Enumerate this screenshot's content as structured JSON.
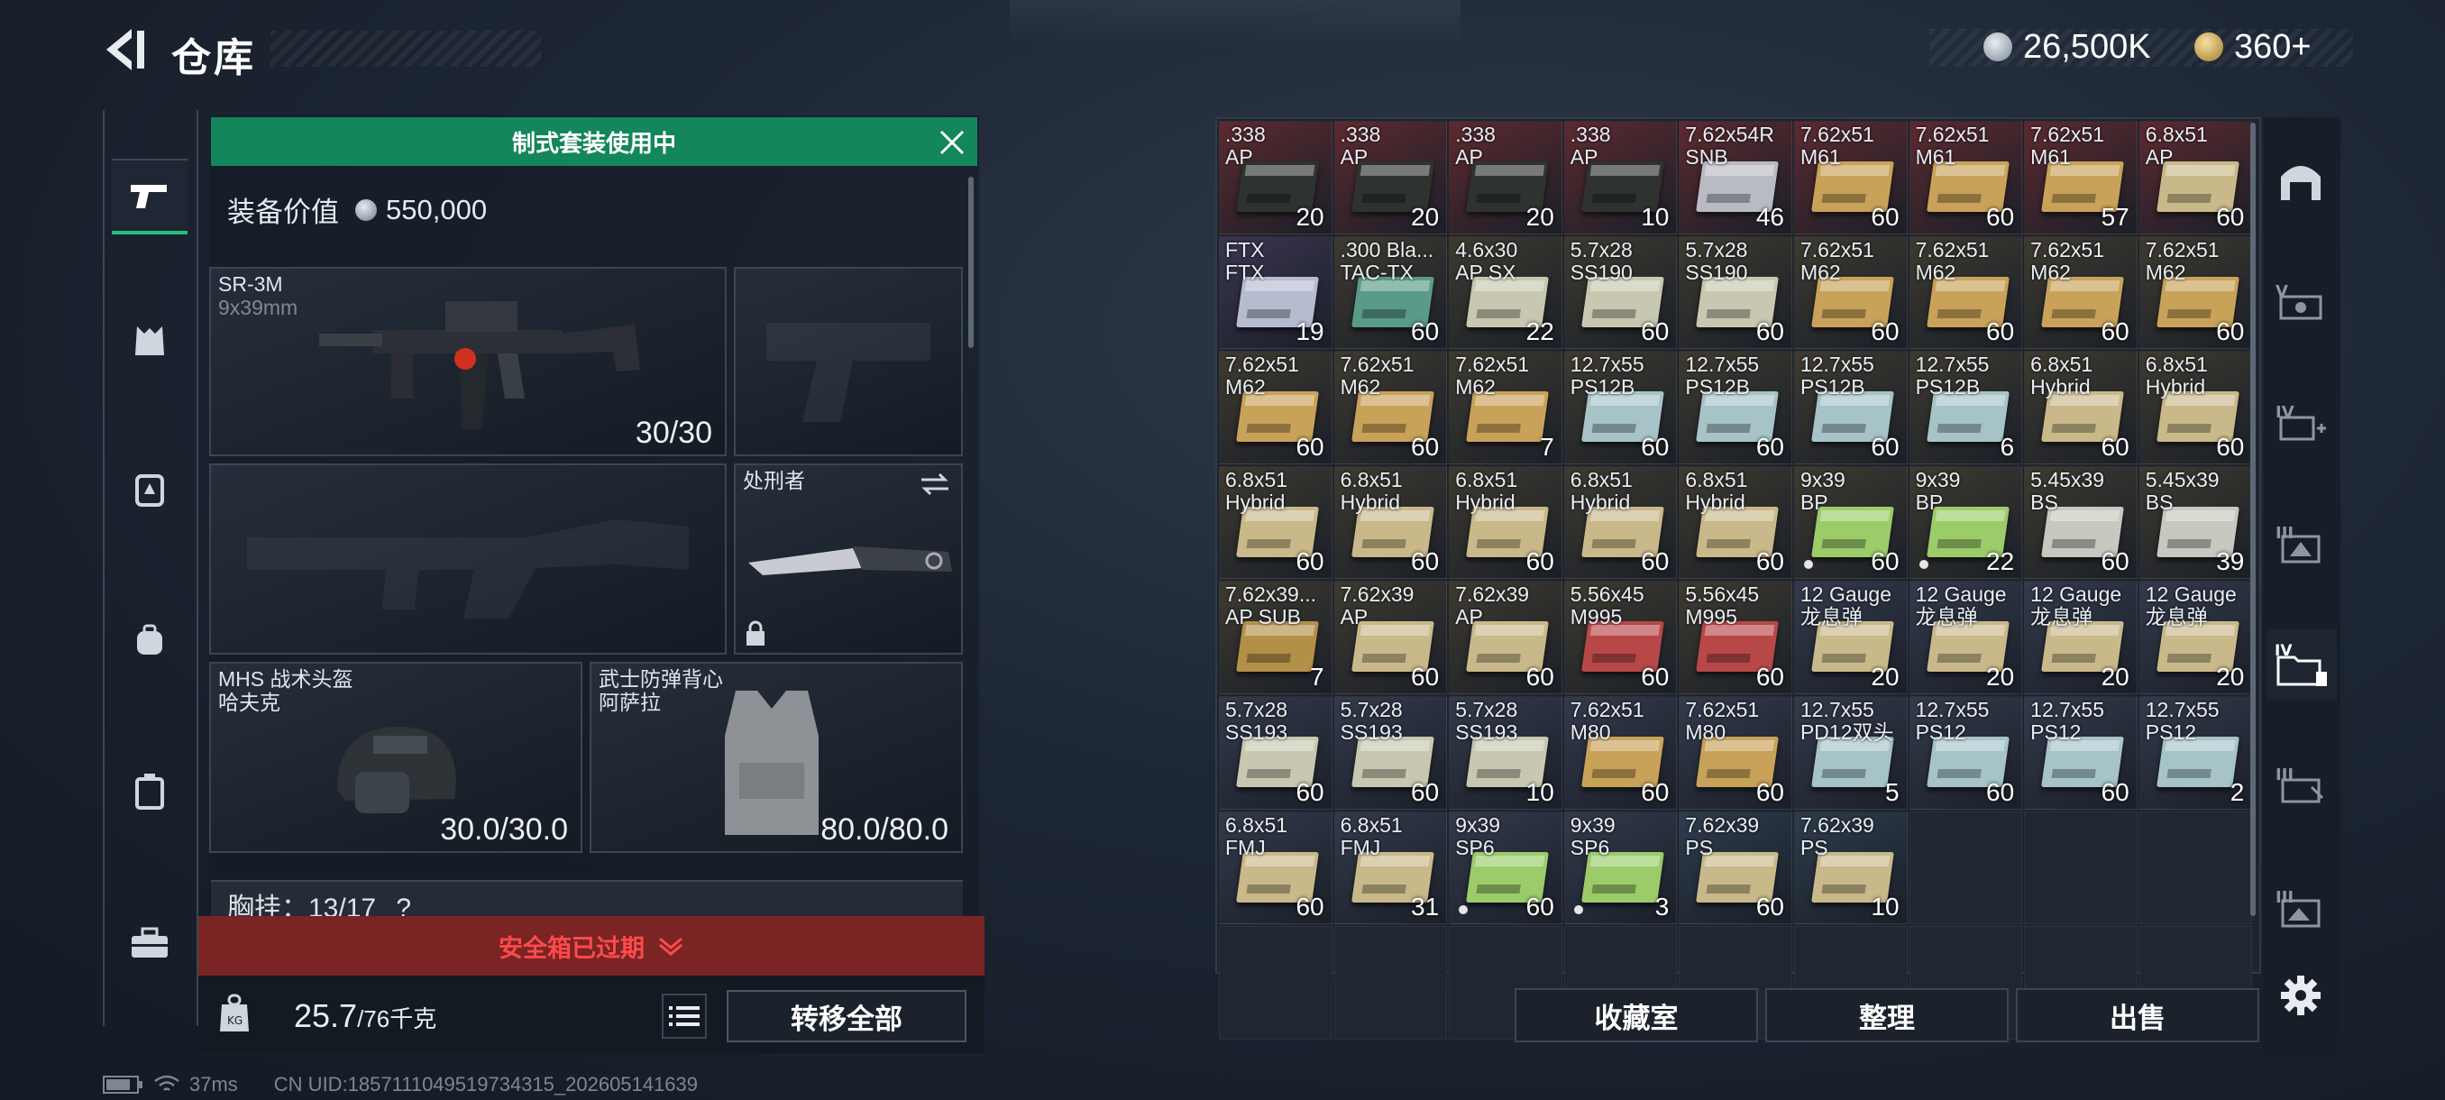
{
  "header": {
    "title": "仓库",
    "currency1": "26,500K",
    "currency2": "360+"
  },
  "loadout": {
    "banner": "制式套装使用中",
    "value_label": "装备价值",
    "value": "550,000",
    "primary": {
      "name": "SR-3M",
      "caliber": "9x39mm",
      "ammo": "30/30"
    },
    "melee": {
      "name": "处刑者"
    },
    "helmet": {
      "name": "MHS 战术头盔",
      "sub": "哈夫克",
      "durability": "30.0/30.0"
    },
    "armor": {
      "name": "武士防弹背心",
      "sub": "阿萨拉",
      "durability": "80.0/80.0"
    },
    "chest_rig": "胸挂：13/17",
    "chest_help": "?",
    "safe_box": "安全箱已过期",
    "weight": "25.7",
    "weight_max": "/76千克",
    "transfer_all": "转移全部"
  },
  "status": {
    "ping": "37ms",
    "uid": "CN UID:1857111049519734315_202605141639"
  },
  "stash": {
    "items": [
      {
        "name": ".338\nAP",
        "qty": "20",
        "bg": "#5c2a30",
        "box": "#2e3330",
        "dot": false
      },
      {
        "name": ".338\nAP",
        "qty": "20",
        "bg": "#5c2a30",
        "box": "#2e3330",
        "dot": false
      },
      {
        "name": ".338\nAP",
        "qty": "20",
        "bg": "#5c2a30",
        "box": "#2e3330",
        "dot": false
      },
      {
        "name": ".338\nAP",
        "qty": "10",
        "bg": "#5c2a30",
        "box": "#2e3330",
        "dot": false
      },
      {
        "name": "7.62x54R\nSNB",
        "qty": "46",
        "bg": "#5c2a30",
        "box": "#b8bcc2",
        "dot": false
      },
      {
        "name": "7.62x51\nM61",
        "qty": "60",
        "bg": "#5c2a30",
        "box": "#c9a25a",
        "dot": false
      },
      {
        "name": "7.62x51\nM61",
        "qty": "60",
        "bg": "#5c2a30",
        "box": "#c9a25a",
        "dot": false
      },
      {
        "name": "7.62x51\nM61",
        "qty": "57",
        "bg": "#5c2a30",
        "box": "#c9a25a",
        "dot": false
      },
      {
        "name": "6.8x51\nAP",
        "qty": "60",
        "bg": "#5c2a30",
        "box": "#c9b98a",
        "dot": false
      },
      {
        "name": "FTX\nFTX",
        "qty": "19",
        "bg": "#3a3550",
        "box": "#b6bcd0",
        "dot": false
      },
      {
        "name": ".300 Bla...\nTAC-TX",
        "qty": "60",
        "bg": "#3e3a30",
        "box": "#5a9a88",
        "dot": false
      },
      {
        "name": "4.6x30\nAP SX",
        "qty": "22",
        "bg": "#3e3a30",
        "box": "#c8c8b0",
        "dot": false
      },
      {
        "name": "5.7x28\nSS190",
        "qty": "60",
        "bg": "#3e3a30",
        "box": "#c8c8b0",
        "dot": false
      },
      {
        "name": "5.7x28\nSS190",
        "qty": "60",
        "bg": "#3e3a30",
        "box": "#c8c8b0",
        "dot": false
      },
      {
        "name": "7.62x51\nM62",
        "qty": "60",
        "bg": "#3e3a30",
        "box": "#c9a25a",
        "dot": false
      },
      {
        "name": "7.62x51\nM62",
        "qty": "60",
        "bg": "#3e3a30",
        "box": "#c9a25a",
        "dot": false
      },
      {
        "name": "7.62x51\nM62",
        "qty": "60",
        "bg": "#3e3a30",
        "box": "#c9a25a",
        "dot": false
      },
      {
        "name": "7.62x51\nM62",
        "qty": "60",
        "bg": "#3e3a30",
        "box": "#c9a25a",
        "dot": false
      },
      {
        "name": "7.62x51\nM62",
        "qty": "60",
        "bg": "#3e3a30",
        "box": "#c9a25a",
        "dot": false
      },
      {
        "name": "7.62x51\nM62",
        "qty": "60",
        "bg": "#3e3a30",
        "box": "#c9a25a",
        "dot": false
      },
      {
        "name": "7.62x51\nM62",
        "qty": "7",
        "bg": "#3e3a30",
        "box": "#c9a25a",
        "dot": false
      },
      {
        "name": "12.7x55\nPS12B",
        "qty": "60",
        "bg": "#3e3a30",
        "box": "#a6c4c8",
        "dot": false
      },
      {
        "name": "12.7x55\nPS12B",
        "qty": "60",
        "bg": "#3e3a30",
        "box": "#a6c4c8",
        "dot": false
      },
      {
        "name": "12.7x55\nPS12B",
        "qty": "60",
        "bg": "#3e3a30",
        "box": "#a6c4c8",
        "dot": false
      },
      {
        "name": "12.7x55\nPS12B",
        "qty": "6",
        "bg": "#3e3a30",
        "box": "#a6c4c8",
        "dot": false
      },
      {
        "name": "6.8x51\nHybrid",
        "qty": "60",
        "bg": "#3e3a30",
        "box": "#c9b98a",
        "dot": false
      },
      {
        "name": "6.8x51\nHybrid",
        "qty": "60",
        "bg": "#3e3a30",
        "box": "#c9b98a",
        "dot": false
      },
      {
        "name": "6.8x51\nHybrid",
        "qty": "60",
        "bg": "#3e3a30",
        "box": "#c9b98a",
        "dot": false
      },
      {
        "name": "6.8x51\nHybrid",
        "qty": "60",
        "bg": "#3e3a30",
        "box": "#c9b98a",
        "dot": false
      },
      {
        "name": "6.8x51\nHybrid",
        "qty": "60",
        "bg": "#3e3a30",
        "box": "#c9b98a",
        "dot": false
      },
      {
        "name": "6.8x51\nHybrid",
        "qty": "60",
        "bg": "#3e3a30",
        "box": "#c9b98a",
        "dot": false
      },
      {
        "name": "6.8x51\nHybrid",
        "qty": "60",
        "bg": "#3e3a30",
        "box": "#c9b98a",
        "dot": false
      },
      {
        "name": "9x39\nBP",
        "qty": "60",
        "bg": "#3e3a30",
        "box": "#9ccc6a",
        "dot": true
      },
      {
        "name": "9x39\nBP",
        "qty": "22",
        "bg": "#3e3a30",
        "box": "#9ccc6a",
        "dot": true
      },
      {
        "name": "5.45x39\nBS",
        "qty": "60",
        "bg": "#3e3a30",
        "box": "#c8c8c0",
        "dot": false
      },
      {
        "name": "5.45x39\nBS",
        "qty": "39",
        "bg": "#3e3a30",
        "box": "#c8c8c0",
        "dot": false
      },
      {
        "name": "7.62x39...\nAP SUB",
        "qty": "7",
        "bg": "#3e3a30",
        "box": "#b39048",
        "dot": false
      },
      {
        "name": "7.62x39\nAP",
        "qty": "60",
        "bg": "#3e3a30",
        "box": "#c9b98a",
        "dot": false
      },
      {
        "name": "7.62x39\nAP",
        "qty": "60",
        "bg": "#3e3a30",
        "box": "#c9b98a",
        "dot": false
      },
      {
        "name": "5.56x45\nM995",
        "qty": "60",
        "bg": "#3e3a30",
        "box": "#b84848",
        "dot": false
      },
      {
        "name": "5.56x45\nM995",
        "qty": "60",
        "bg": "#3e3a30",
        "box": "#b84848",
        "dot": false
      },
      {
        "name": "12 Gauge\n龙息弹",
        "qty": "20",
        "bg": "#343a4c",
        "box": "#c9b98a",
        "dot": false
      },
      {
        "name": "12 Gauge\n龙息弹",
        "qty": "20",
        "bg": "#343a4c",
        "box": "#c9b98a",
        "dot": false
      },
      {
        "name": "12 Gauge\n龙息弹",
        "qty": "20",
        "bg": "#343a4c",
        "box": "#c9b98a",
        "dot": false
      },
      {
        "name": "12 Gauge\n龙息弹",
        "qty": "20",
        "bg": "#343a4c",
        "box": "#c9b98a",
        "dot": false
      },
      {
        "name": "5.7x28\nSS193",
        "qty": "60",
        "bg": "#343a4c",
        "box": "#c8c8b0",
        "dot": false
      },
      {
        "name": "5.7x28\nSS193",
        "qty": "60",
        "bg": "#343a4c",
        "box": "#c8c8b0",
        "dot": false
      },
      {
        "name": "5.7x28\nSS193",
        "qty": "10",
        "bg": "#343a4c",
        "box": "#c8c8b0",
        "dot": false
      },
      {
        "name": "7.62x51\nM80",
        "qty": "60",
        "bg": "#343a4c",
        "box": "#c9a25a",
        "dot": false
      },
      {
        "name": "7.62x51\nM80",
        "qty": "60",
        "bg": "#343a4c",
        "box": "#c9a25a",
        "dot": false
      },
      {
        "name": "12.7x55\nPD12双头",
        "qty": "5",
        "bg": "#343a4c",
        "box": "#a6c4c8",
        "dot": false
      },
      {
        "name": "12.7x55\nPS12",
        "qty": "60",
        "bg": "#343a4c",
        "box": "#a6c4c8",
        "dot": false
      },
      {
        "name": "12.7x55\nPS12",
        "qty": "60",
        "bg": "#343a4c",
        "box": "#a6c4c8",
        "dot": false
      },
      {
        "name": "12.7x55\nPS12",
        "qty": "2",
        "bg": "#343a4c",
        "box": "#a6c4c8",
        "dot": false
      },
      {
        "name": "6.8x51\nFMJ",
        "qty": "60",
        "bg": "#343a4c",
        "box": "#c9b98a",
        "dot": false
      },
      {
        "name": "6.8x51\nFMJ",
        "qty": "31",
        "bg": "#343a4c",
        "box": "#c9b98a",
        "dot": false
      },
      {
        "name": "9x39\nSP6",
        "qty": "60",
        "bg": "#343a4c",
        "box": "#9ccc6a",
        "dot": true
      },
      {
        "name": "9x39\nSP6",
        "qty": "3",
        "bg": "#343a4c",
        "box": "#9ccc6a",
        "dot": true
      },
      {
        "name": "7.62x39\nPS",
        "qty": "60",
        "bg": "#2e3c4c",
        "box": "#c9b98a",
        "dot": false
      },
      {
        "name": "7.62x39\nPS",
        "qty": "10",
        "bg": "#2e3c4c",
        "box": "#c9b98a",
        "dot": false
      }
    ],
    "empty_cells": 12
  },
  "actions": {
    "collection": "收藏室",
    "sort": "整理",
    "sell": "出售"
  }
}
